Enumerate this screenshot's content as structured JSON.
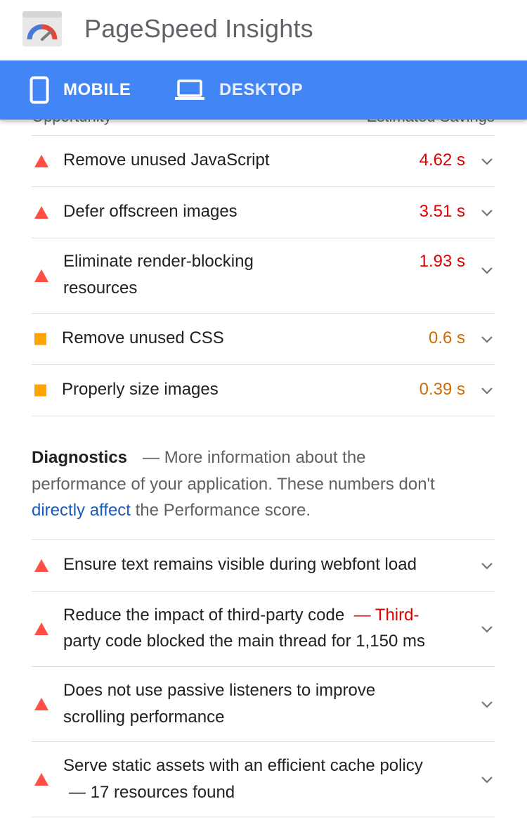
{
  "app": {
    "title": "PageSpeed Insights"
  },
  "tabs": [
    {
      "label": "MOBILE",
      "icon": "phone-icon",
      "active": true
    },
    {
      "label": "DESKTOP",
      "icon": "laptop-icon",
      "active": false
    }
  ],
  "opportunities": {
    "header": {
      "left": "Opportunity",
      "right": "Estimated Savings"
    },
    "items": [
      {
        "title": "Remove unused JavaScript",
        "savings": "4.62 s",
        "status": "fail"
      },
      {
        "title": "Defer offscreen images",
        "savings": "3.51 s",
        "status": "fail"
      },
      {
        "title": "Eliminate render-blocking",
        "title2": "resources",
        "savings": "1.93 s",
        "status": "fail"
      },
      {
        "title": "Remove unused CSS",
        "savings": "0.6 s",
        "status": "average"
      },
      {
        "title": "Properly size images",
        "savings": "0.39 s",
        "status": "average"
      }
    ]
  },
  "diagnostics": {
    "heading": "Diagnostics",
    "desc_1": "— More information about the",
    "desc_2": "performance of your application. These numbers don't",
    "link": "directly affect",
    "desc_3": " the Performance score.",
    "items": [
      {
        "title": "Ensure text remains visible during webfont load",
        "status": "fail"
      },
      {
        "title": "Reduce the impact of third-party code",
        "detail_1": "— Third-",
        "detail_2": "party code blocked the main thread for 1,150 ms",
        "status": "fail"
      },
      {
        "title": "Does not use passive listeners to improve",
        "title2": "scrolling performance",
        "status": "fail"
      },
      {
        "title": "Serve static assets with an efficient cache policy",
        "detail": "— 17 resources found",
        "status": "fail"
      }
    ]
  },
  "colors": {
    "tab_bar": "#4285f4",
    "fail": "#ff4e42",
    "average": "#ffa400",
    "link": "#1a5bb8"
  }
}
